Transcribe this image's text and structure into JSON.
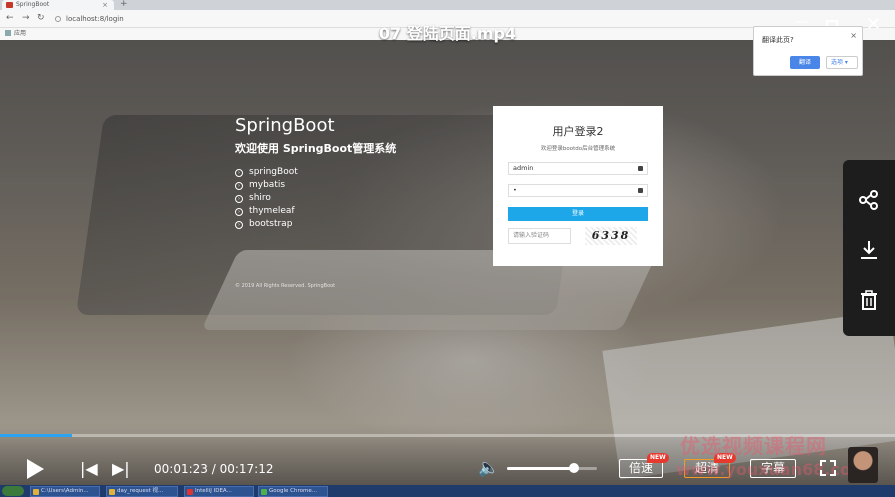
{
  "browser": {
    "tab_title": "SpringBoot",
    "url": "localhost:8/login",
    "bookmarks_label": "应用"
  },
  "video": {
    "title": "07 登陆页面.mp4",
    "current_time": "00:01:23",
    "total_time": "00:17:12",
    "progress_fraction": 0.08,
    "volume_fraction": 0.74,
    "speed_label": "倍速",
    "quality_label": "超清",
    "subtitle_label": "字幕",
    "new_badge": "NEW"
  },
  "translate_popup": {
    "question": "翻译此页?",
    "translate_button": "翻译",
    "options_button": "选项"
  },
  "intro": {
    "brand": "SpringBoot",
    "subtitle": "欢迎使用 SpringBoot管理系统",
    "features": [
      "springBoot",
      "mybatis",
      "shiro",
      "thymeleaf",
      "bootstrap"
    ],
    "copyright": "© 2019 All Rights Reserved. SpringBoot"
  },
  "login": {
    "title": "用户登录2",
    "welcome": "欢迎登录bootdo后台管理系统",
    "username": "admin",
    "password": "•",
    "login_button": "登录",
    "code_placeholder": "请输入验证码",
    "captcha_text": "6338"
  },
  "watermark": {
    "line1": "优选视频课程网",
    "line2": "www.youxuan68.com"
  },
  "taskbar": {
    "items": [
      "C:\\Users\\Admin...",
      "day_request 视...",
      "IntelliJ IDEA...",
      "Google Chrome..."
    ]
  },
  "colors": {
    "progress": "#2aa3f0",
    "login_button": "#1ea7e8",
    "badge": "#e73a2f",
    "translate_button": "#4a85e8"
  }
}
